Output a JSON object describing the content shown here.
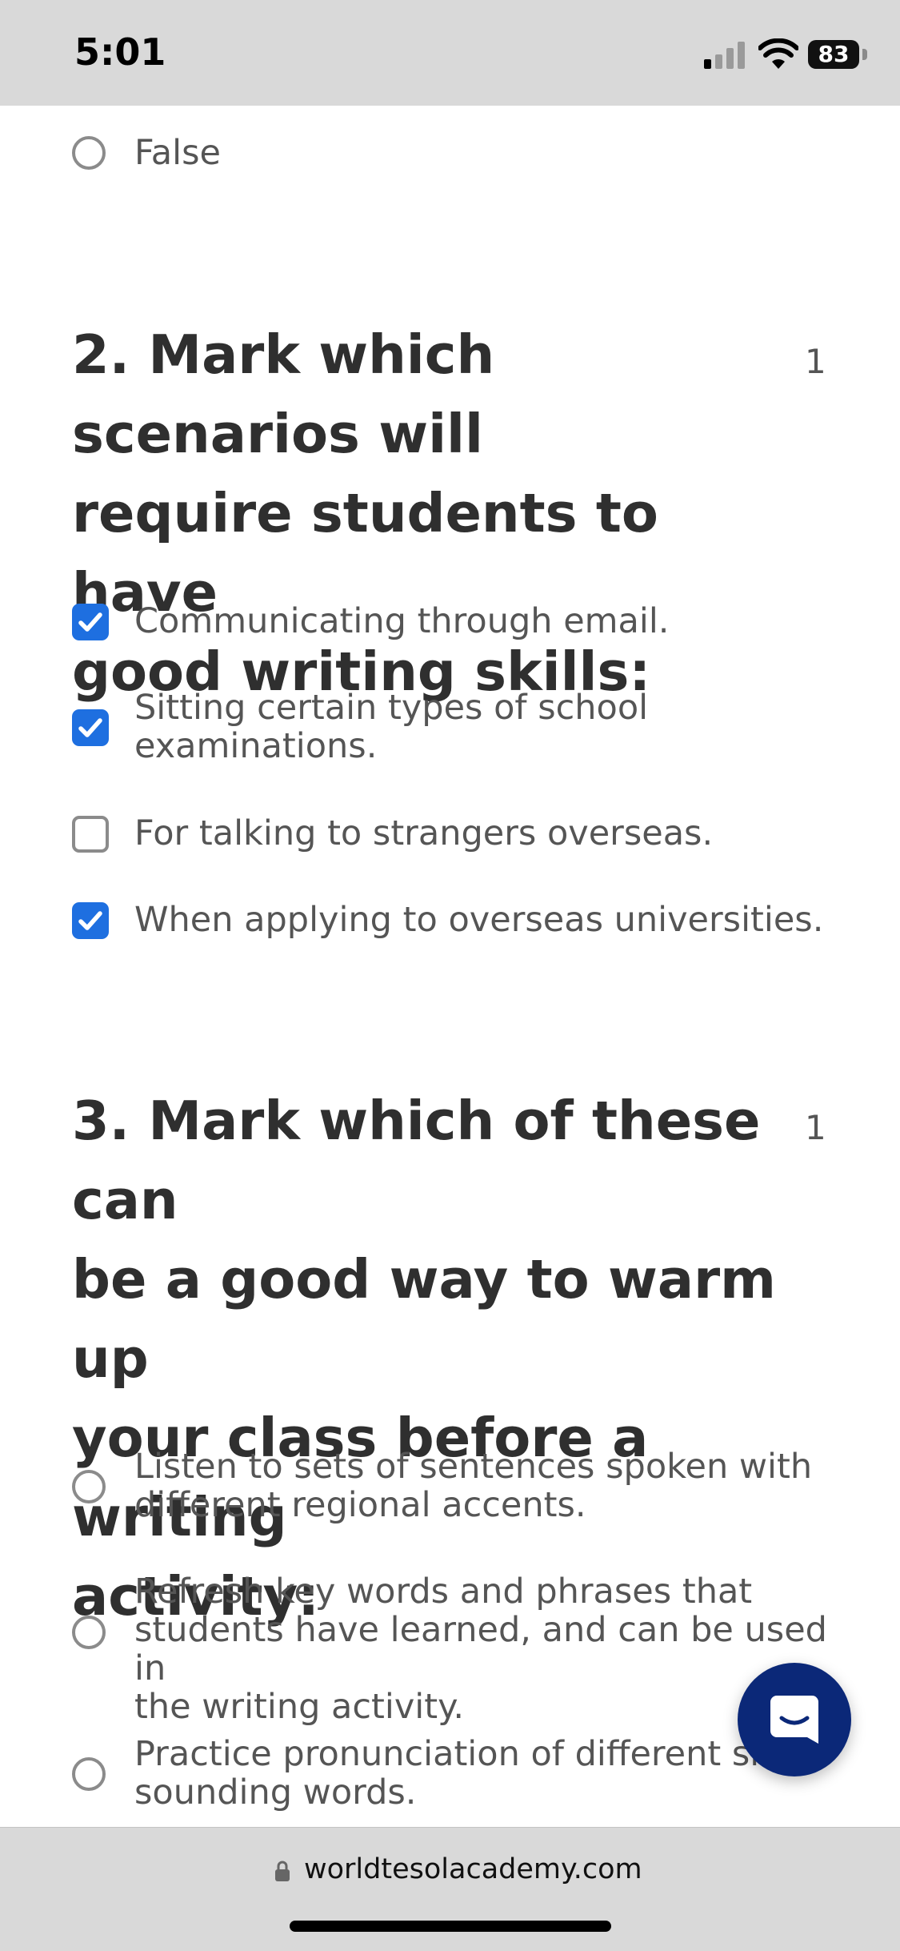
{
  "status_bar": {
    "time": "5:01",
    "battery_level": "83"
  },
  "quiz": {
    "q1_options": [
      {
        "label": "False",
        "selected": false
      }
    ],
    "q2": {
      "title": "2. Mark which scenarios will require students to have good writing skills:",
      "title_lines": [
        "2. Mark which scenarios will",
        "require students to have",
        "good writing skills:"
      ],
      "points": "1",
      "options": [
        {
          "label": "Communicating through email.",
          "checked": true
        },
        {
          "label": "Sitting certain types of school examinations.",
          "lines": [
            "Sitting certain types of school",
            "examinations."
          ],
          "checked": true
        },
        {
          "label": "For talking to strangers overseas.",
          "checked": false
        },
        {
          "label": "When applying to overseas universities.",
          "checked": true
        }
      ]
    },
    "q3": {
      "title": "3. Mark which of these can be a good way to warm up your class before a writing activity:",
      "title_lines": [
        "3. Mark which of these can",
        "be a good way to warm up",
        "your class before a writing",
        "activity:"
      ],
      "points": "1",
      "options": [
        {
          "label": "Listen to sets of sentences spoken with different regional accents.",
          "lines": [
            "Listen to sets of sentences spoken with",
            "different regional accents."
          ],
          "selected": false
        },
        {
          "label": "Refresh key words and phrases that students have learned, and can be used in the writing activity.",
          "lines": [
            "Refresh key words and phrases that",
            "students have learned, and can be used in",
            "the writing activity."
          ],
          "selected": false
        },
        {
          "label": "Practice pronunciation of different similar sounding words.",
          "lines": [
            "Practice pronunciation of different sim",
            "sounding words."
          ],
          "selected": false
        }
      ]
    }
  },
  "browser": {
    "url": "worldtesolacademy.com"
  },
  "colors": {
    "accent": "#1e6fe0",
    "chat_button": "#0b2878",
    "bars": "#d9d9d9"
  },
  "icons": [
    "signal-icon",
    "wifi-icon",
    "battery-icon",
    "checkmark-icon",
    "chat-icon",
    "lock-icon"
  ]
}
